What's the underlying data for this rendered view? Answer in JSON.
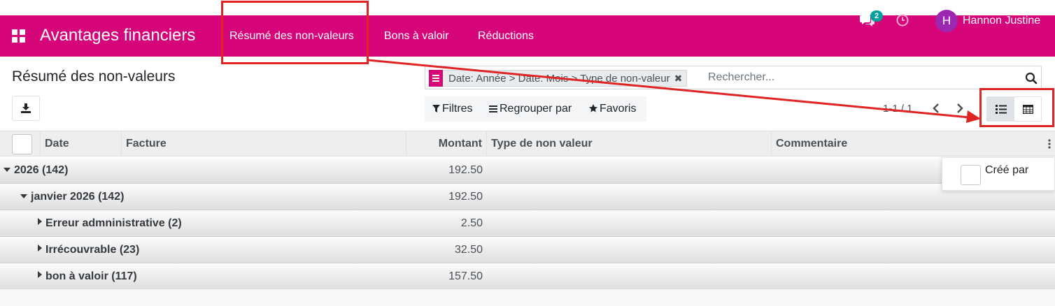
{
  "navbar": {
    "app_title": "Avantages financiers",
    "menu": [
      "Résumé des non-valeurs",
      "Bons à valoir",
      "Réductions"
    ],
    "chat_badge": "2",
    "avatar_letter": "H",
    "user_name": "Hannon Justine"
  },
  "control_panel": {
    "page_title": "Résumé des non-valeurs",
    "facet": "Date: Année > Date: Mois > Type de non-valeur",
    "search_placeholder": "Rechercher...",
    "filters_label": "Filtres",
    "group_by_label": "Regrouper par",
    "favorites_label": "Favoris",
    "pager": "1-1 / 1"
  },
  "table": {
    "columns": [
      "Date",
      "Facture",
      "Montant",
      "Type de non valeur",
      "Commentaire"
    ],
    "groups": [
      {
        "name": "2026 (142)",
        "amount": "192.50",
        "level": 0,
        "open": true
      },
      {
        "name": "janvier 2026 (142)",
        "amount": "192.50",
        "level": 1,
        "open": true
      },
      {
        "name": "Erreur admninistrative (2)",
        "amount": "2.50",
        "level": 2,
        "open": false
      },
      {
        "name": "Irrécouvrable (23)",
        "amount": "32.50",
        "level": 2,
        "open": false
      },
      {
        "name": "bon à valoir (117)",
        "amount": "157.50",
        "level": 2,
        "open": false
      }
    ]
  },
  "optional_columns": {
    "created_by_label": "Créé par"
  },
  "colors": {
    "brand": "#d6067a",
    "annotation": "#e02424",
    "badge": "#00a09d"
  }
}
